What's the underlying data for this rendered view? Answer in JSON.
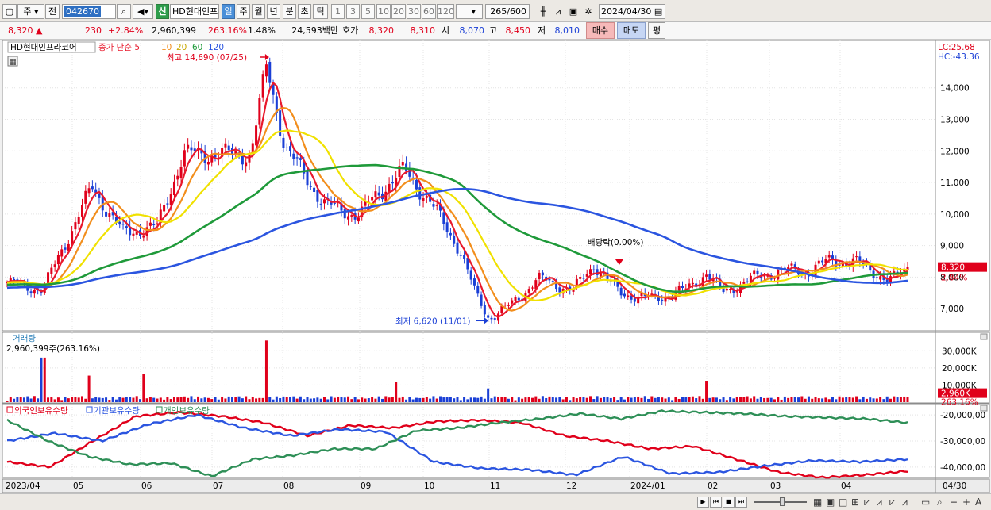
{
  "toolbar": {
    "period_cycle": "주",
    "prev_label": "전",
    "stock_code": "042670",
    "new_label": "신",
    "stock_name": "HD현대인프",
    "periods": [
      "일",
      "주",
      "월",
      "년",
      "분",
      "초",
      "틱"
    ],
    "active_period": "일",
    "intervals": [
      "1",
      "3",
      "5",
      "10",
      "20",
      "30",
      "60",
      "120"
    ],
    "count": "265",
    "count_total": "/600",
    "date": "2024/04/30"
  },
  "info": {
    "price": "8,320",
    "change": "230",
    "change_pct": "+2.84%",
    "volume": "2,960,399",
    "volume_ratio": "263.16%",
    "turnover": "1.48%",
    "amount": "24,593백만",
    "quote_label": "호가",
    "ask": "8,320",
    "bid": "8,310",
    "open_label": "시",
    "open": "8,070",
    "high_label": "고",
    "high": "8,450",
    "low_label": "저",
    "low": "8,010",
    "buy_label": "매수",
    "sell_label": "매도",
    "avg_label": "평"
  },
  "chart_data": {
    "type": "candlestick",
    "title": "HD현대인프라코어",
    "legend": [
      "종가 단순 5",
      "10",
      "20",
      "60",
      "120"
    ],
    "legend_colors": [
      "#e8192c",
      "#f28e1c",
      "#f0e100",
      "#1f9a3a",
      "#2b55e0"
    ],
    "y_ticks": [
      "14,000",
      "13,000",
      "12,000",
      "11,000",
      "10,000",
      "9,000",
      "8,000",
      "7,000"
    ],
    "y_tick_values": [
      14000,
      13000,
      12000,
      11000,
      10000,
      9000,
      8000,
      7000
    ],
    "ylim": [
      6300,
      15200
    ],
    "x_labels": [
      "2023/04",
      "05",
      "06",
      "07",
      "08",
      "09",
      "10",
      "11",
      "12",
      "2024/01",
      "02",
      "03",
      "04"
    ],
    "last_date_label": "04/30",
    "lc": "LC:25.68",
    "hc": "HC:-43.36",
    "last_price_label": "8,320",
    "last_pct_label": "2.84%",
    "annotations": {
      "high": "최고 14,690 (07/25)",
      "low": "최저 6,620 (11/01)",
      "dividend": "배당락(0.00%)"
    },
    "price_anchor_dates": [
      "04/01",
      "04/18",
      "05/10",
      "05/24",
      "06/08",
      "06/19",
      "07/02",
      "07/18",
      "07/25",
      "08/02",
      "08/18",
      "09/01",
      "09/08",
      "09/22",
      "10/04",
      "10/18",
      "10/26",
      "11/01",
      "11/10",
      "11/20",
      "12/05",
      "12/15",
      "12/27",
      "01/10",
      "01/24",
      "02/01",
      "02/08",
      "02/20",
      "03/05",
      "03/18",
      "03/28",
      "04/08",
      "04/16",
      "04/22",
      "04/30"
    ],
    "price_anchors": [
      7850,
      7600,
      10850,
      9400,
      9600,
      11900,
      11900,
      11900,
      14690,
      12100,
      10300,
      9950,
      10550,
      11400,
      10400,
      8900,
      7400,
      6700,
      7150,
      7950,
      7600,
      8400,
      7500,
      7300,
      7600,
      8150,
      7500,
      7900,
      8200,
      8200,
      8550,
      8450,
      8150,
      7850,
      8320
    ],
    "volume_panel": {
      "title": "거래량",
      "current": "2,960,399주(263.16%)",
      "y_ticks": [
        "30,000K",
        "20,000K",
        "10,000K"
      ],
      "y_tick_values": [
        30000,
        20000,
        10000
      ],
      "ymax_k": 38000,
      "last_label": "2,960K",
      "last_pct_label": "263.16%",
      "spike_dates": [
        "04/18",
        "05/09",
        "06/02",
        "07/25",
        "09/18",
        "10/31",
        "02/01",
        "04/30"
      ],
      "spike_values_k": [
        26000,
        15500,
        16500,
        36000,
        12000,
        8000,
        12500,
        2960
      ]
    },
    "holding_panel": {
      "series_names": [
        "외국인보유수량",
        "기관보유수량",
        "개인보유수량"
      ],
      "series_colors": [
        "#e0001b",
        "#2b55e0",
        "#2e8f57"
      ],
      "y_ticks": [
        "-20,000,00",
        "-30,000,00",
        "-40,000,00"
      ],
      "y_tick_values": [
        -20000000,
        -30000000,
        -40000000
      ],
      "ylim": [
        -44000000,
        -16000000
      ],
      "foreign_anchors": [
        -38000000,
        -40000000,
        -30000000,
        -20500000,
        -19000000,
        -20500000,
        -23000000,
        -28000000,
        -24000000,
        -25000000,
        -22500000,
        -22000000,
        -23000000,
        -28000000,
        -30000000,
        -33000000,
        -32000000,
        -37000000,
        -42000000,
        -44000000,
        -43000000,
        -41500000
      ],
      "institution_anchors": [
        -30000000,
        -27000000,
        -30000000,
        -23500000,
        -20000000,
        -25000000,
        -28000000,
        -25500000,
        -26500000,
        -38000000,
        -40500000,
        -41000000,
        -43000000,
        -36000000,
        -42500000,
        -42000000,
        -39500000,
        -37500000,
        -38000000,
        -37000000
      ],
      "individual_anchors": [
        -22000000,
        -30000000,
        -36000000,
        -39000000,
        -38500000,
        -43500000,
        -37000000,
        -35500000,
        -33000000,
        -33000000,
        -26000000,
        -25000000,
        -23000000,
        -21500000,
        -19500000,
        -21500000,
        -18500000,
        -19000000,
        -19500000,
        -20500000,
        -21000000,
        -21500000,
        -23000000
      ]
    }
  },
  "statusbar": {
    "controls": [
      "▶",
      "⏮",
      "■",
      "⏭"
    ],
    "right_icons": [
      "search-icon",
      "zoom-out-icon",
      "zoom-in-icon"
    ]
  }
}
